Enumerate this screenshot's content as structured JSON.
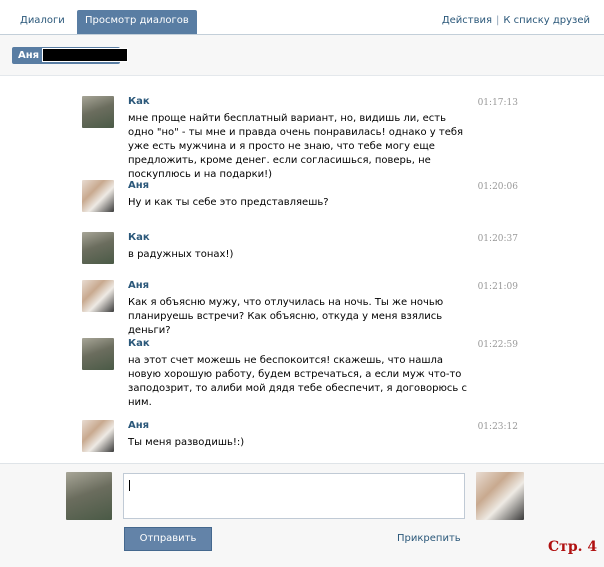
{
  "tabs": [
    {
      "label": "Диалоги"
    },
    {
      "label": "Просмотр диалогов"
    }
  ],
  "header_actions": {
    "actions": "Действия",
    "to_friends": "К списку друзей"
  },
  "filter": {
    "name": "Аня"
  },
  "messages": [
    {
      "author": "Как",
      "time": "01:17:13",
      "text": "мне проще найти бесплатный вариант, но, видишь ли, есть одно \"но\" - ты мне и правда очень понравилась! однако у тебя уже есть мужчина и я просто не знаю, что тебе могу еще предложить, кроме денег. если согласишься, поверь, не поскуплюсь и на подарки!)"
    },
    {
      "author": "Аня",
      "time": "01:20:06",
      "text": "Ну и как ты себе это представляешь?"
    },
    {
      "author": "Как",
      "time": "01:20:37",
      "text": "в радужных тонах!)"
    },
    {
      "author": "Аня",
      "time": "01:21:09",
      "text": "Как я объясню мужу, что отлучилась на ночь. Ты же ночью планируешь встречи? Как объясню, откуда у меня взялись деньги?"
    },
    {
      "author": "Как",
      "time": "01:22:59",
      "text": "на этот счет можешь не беспокоится! скажешь, что нашла новую хорошую работу, будем встречаться, а если муж что-то заподозрит, то алиби мой дядя тебе обеспечит, я договорюсь с ним."
    },
    {
      "author": "Аня",
      "time": "01:23:12",
      "text": "Ты меня разводишь!:)"
    }
  ],
  "composer": {
    "send_label": "Отправить",
    "attach_label": "Прикрепить"
  },
  "page_mark": "Стр. 4"
}
